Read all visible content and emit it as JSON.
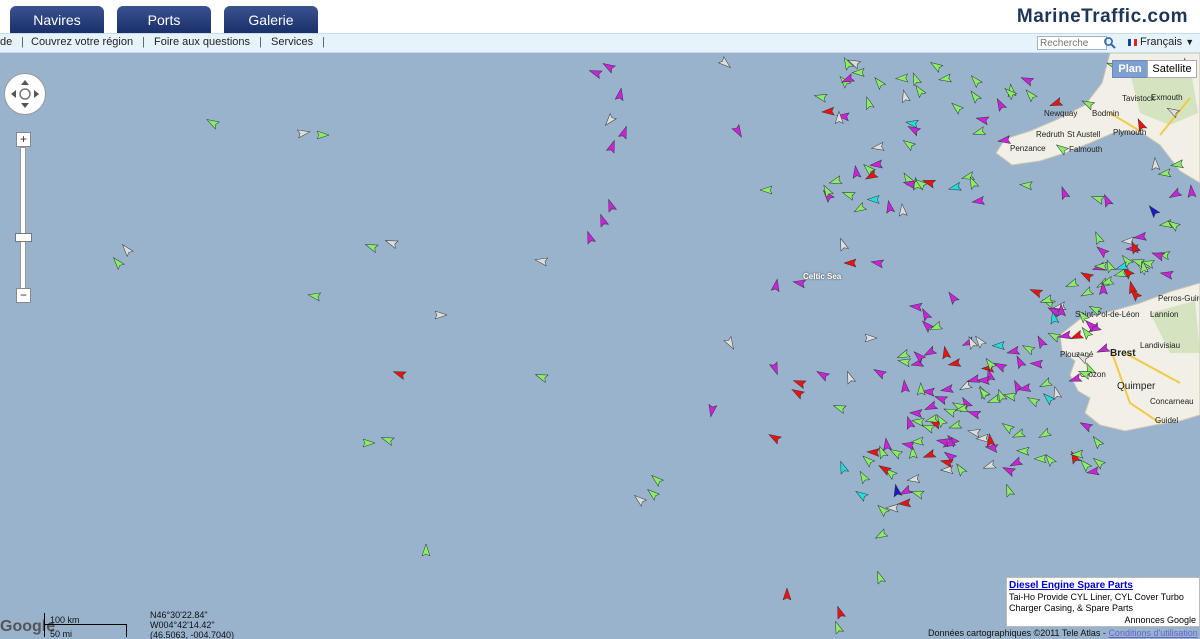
{
  "nav": {
    "tabs": [
      "Navires",
      "Ports",
      "Galerie"
    ]
  },
  "brand": "MarineTraffic.com",
  "menu": {
    "items": [
      "de",
      "Couvrez votre région",
      "Foire aux questions",
      "Services"
    ]
  },
  "search": {
    "placeholder": "Recherche"
  },
  "language": {
    "label": "Français"
  },
  "map_controls": {
    "plan": "Plan",
    "satellite": "Satellite",
    "zoom_in": "+",
    "zoom_out": "−"
  },
  "overlay": {
    "scale_km": "100 km",
    "scale_mi": "50 mi",
    "coord_lat": "N46°30'22.84\"",
    "coord_lon": "W004°42'14.42\"",
    "coord_decimal": "(46.5063, -004.7040)",
    "google": "Google",
    "copyright": "Données cartographiques ©2011 Tele Atlas -",
    "terms_link": "Conditions d'utilisation"
  },
  "ad": {
    "title": "Diesel Engine Spare Parts",
    "body": "Tai-Ho Provide CYL Liner, CYL Cover Turbo Charger Casing, & Spare Parts",
    "annonces": "Annonces Google"
  },
  "places": [
    "Tavistock",
    "Exmouth",
    "Newquay",
    "Bodmin",
    "Redruth",
    "St Austell",
    "Plymouth",
    "Penzance",
    "Falmouth",
    "Perros-Guirec",
    "Lannion",
    "Saint-Pol-de-Léon",
    "Plouzané",
    "Brest",
    "Landivisiau",
    "Crozon",
    "Quimper",
    "Concarneau",
    "Guidel",
    "Celtic Sea"
  ],
  "vessel_colors": {
    "passenger": "#1a1acc",
    "cargo": "#88ee66",
    "tanker": "#ee1111",
    "pleasure": "#cc22dd",
    "other": "#dddddd",
    "tug": "#22dddd"
  },
  "icons": {
    "search": "search-icon",
    "pan": "pan-control-icon",
    "flag": "flag-france-icon",
    "dropdown": "chevron-down-icon"
  }
}
